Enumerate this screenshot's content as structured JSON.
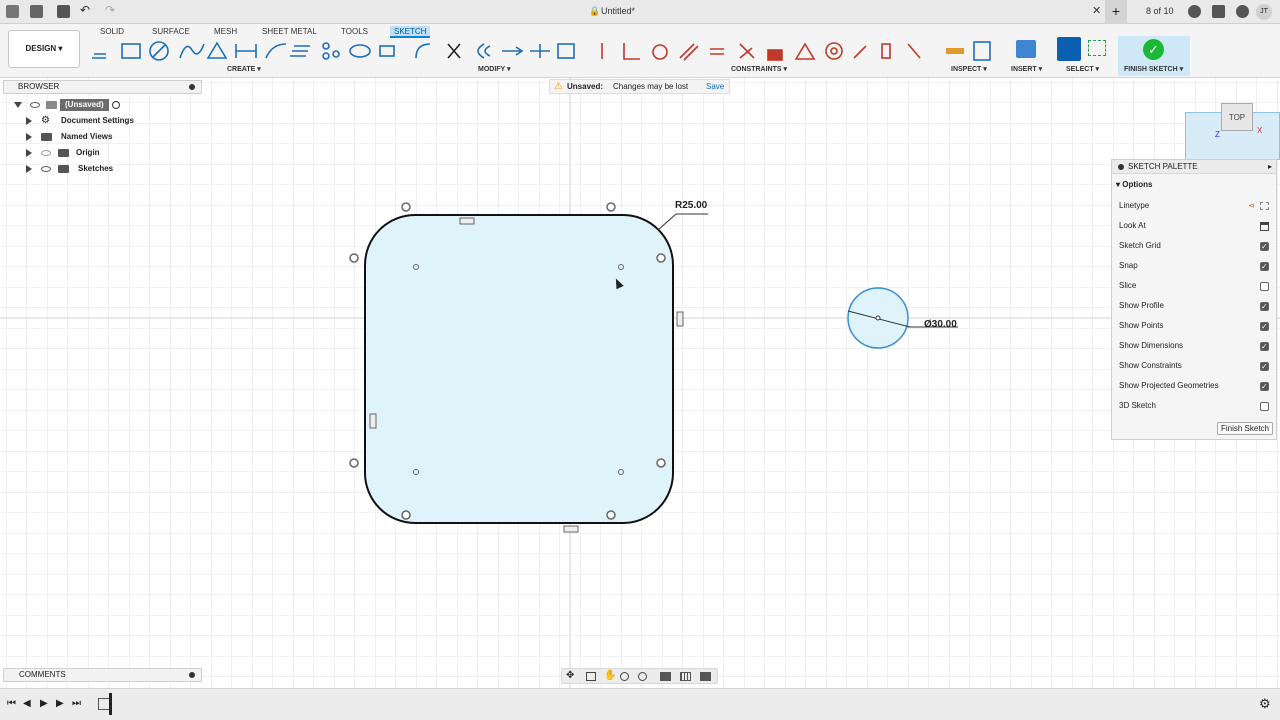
{
  "window": {
    "title": "Untitled*",
    "page_indicator": "8 of 10",
    "user_initials": "JT"
  },
  "ribbon": {
    "workspace_label": "DESIGN ▾",
    "tabs": [
      "SOLID",
      "SURFACE",
      "MESH",
      "SHEET METAL",
      "TOOLS",
      "SKETCH"
    ],
    "groups": [
      "CREATE ▾",
      "MODIFY ▾",
      "CONSTRAINTS ▾",
      "INSPECT ▾",
      "INSERT ▾",
      "SELECT ▾",
      "FINISH SKETCH ▾"
    ]
  },
  "browser": {
    "title": "BROWSER",
    "root": "(Unsaved)",
    "items": [
      "Document Settings",
      "Named Views",
      "Origin",
      "Sketches"
    ]
  },
  "notice": {
    "label": "Unsaved:",
    "message": "Changes may be lost",
    "action": "Save"
  },
  "canvas": {
    "radius_dim": "R25.00",
    "diameter_dim": "Ø30.00",
    "viewcube_label": "TOP"
  },
  "palette": {
    "title": "SKETCH PALETTE",
    "section": "Options",
    "rows": [
      {
        "label": "Linetype",
        "value": null
      },
      {
        "label": "Look At",
        "value": null
      },
      {
        "label": "Sketch Grid",
        "value": true
      },
      {
        "label": "Snap",
        "value": true
      },
      {
        "label": "Slice",
        "value": false
      },
      {
        "label": "Show Profile",
        "value": true
      },
      {
        "label": "Show Points",
        "value": true
      },
      {
        "label": "Show Dimensions",
        "value": true
      },
      {
        "label": "Show Constraints",
        "value": true
      },
      {
        "label": "Show Projected Geometries",
        "value": true
      },
      {
        "label": "3D Sketch",
        "value": false
      }
    ],
    "finish_label": "Finish Sketch"
  },
  "comments": {
    "title": "COMMENTS"
  },
  "colors": {
    "accent": "#0a84d6",
    "sketch_fill": "#dff3fa",
    "finish_green": "#1ab934",
    "select_blue": "#0b5fb0"
  }
}
